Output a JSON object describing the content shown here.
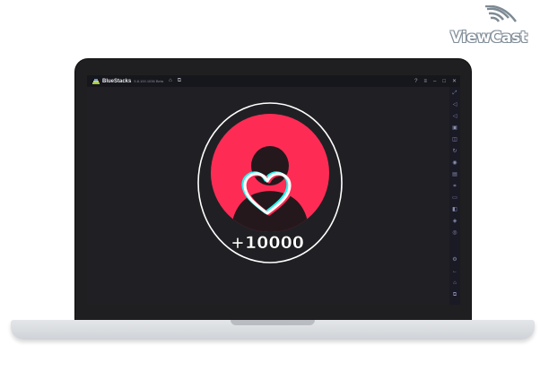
{
  "watermark": {
    "text": "ViewCast"
  },
  "window": {
    "title": "BlueStacks",
    "version": "5.8.100.1036 Beta",
    "controls": [
      "home-icon",
      "multi-instance-icon",
      "help-icon",
      "menu-icon",
      "minimize-icon",
      "maximize-icon",
      "close-icon"
    ]
  },
  "sidebar": {
    "icons": [
      "fullscreen-icon",
      "volume-up-icon",
      "volume-down-icon",
      "screen-record-icon",
      "screenshot-icon",
      "rotate-icon",
      "shake-icon",
      "macro-icon",
      "scan-icon",
      "folder-icon",
      "apk-icon",
      "layers-icon",
      "eco-mode-icon",
      "settings-icon",
      "back-icon",
      "android-home-icon",
      "recent-apps-icon"
    ]
  },
  "app": {
    "counter_text": "+10000",
    "colors": {
      "circle": "#fe2c55",
      "ring": "#ffffff",
      "silhouette": "#24181c",
      "heart_cyan": "#25f4ee",
      "heart_pink": "#fe2c55",
      "background": "#202024"
    }
  }
}
